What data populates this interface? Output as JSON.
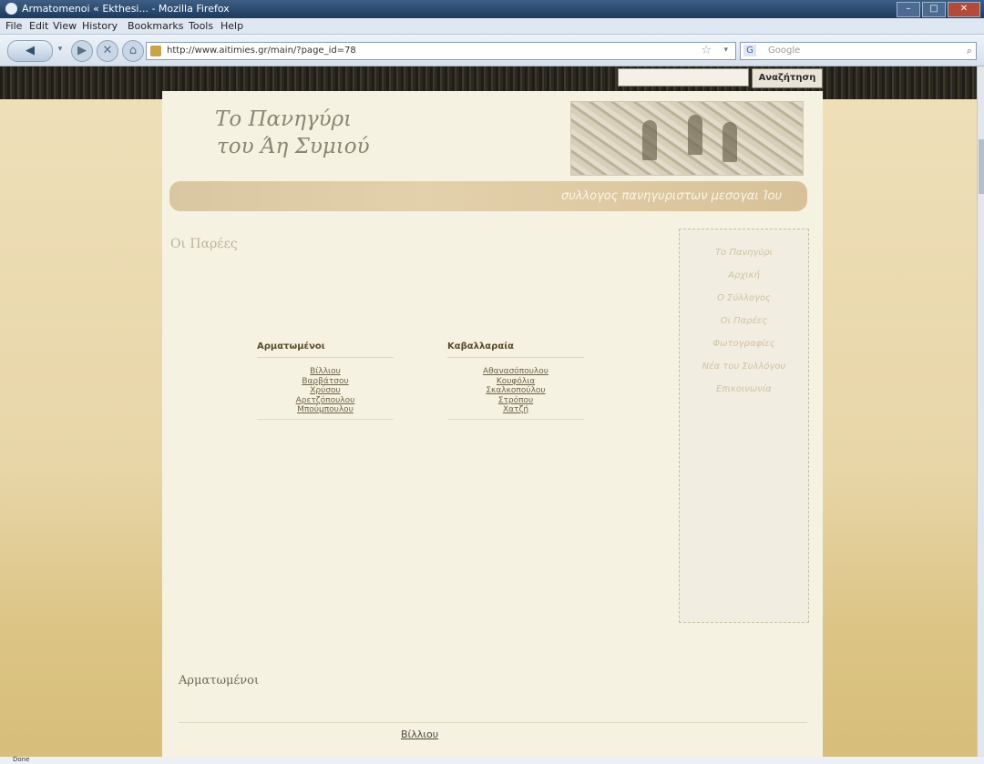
{
  "window": {
    "title": "Armatomenoi « Ekthesi... - Mozilla Firefox"
  },
  "menubar": {
    "items": [
      "File",
      "Edit",
      "View",
      "History",
      "Bookmarks",
      "Tools",
      "Help"
    ]
  },
  "nav": {
    "url": "http://www.aitimies.gr/main/?page_id=78",
    "search_placeholder": "Google"
  },
  "site": {
    "search_button": "Αναζήτηση",
    "logo_line1": "Το Πανηγύρι",
    "logo_line2": "του Άη Συμιού",
    "banner": "συλλογος πανηγυριστων μεσογαι Ίου",
    "page_heading": "Οι Παρέες",
    "groups": [
      {
        "title": "Αρματωμένοι",
        "items": [
          "Βίλλιου",
          "Βαρβάτσου",
          "Χρύσου",
          "Αρετζόπουλου",
          "Μπούμπουλου"
        ]
      },
      {
        "title": "Καβαλλαραία",
        "items": [
          "Αθανασόπουλου",
          "Κουφόλια",
          "Σκαλκοπούλου",
          "Στρόπου",
          "Χατζή"
        ]
      }
    ],
    "sidenav": [
      "Το Πανηγύρι",
      "Αρχική",
      "Ο Σύλλογος",
      "Οι Παρέες",
      "Φωτογραφίες",
      "Νέα του Συλλόγου",
      "Επικοινωνία"
    ],
    "section_heading": "Αρματωμένοι",
    "bottom_link": "Βίλλιου"
  },
  "status": {
    "text": "Done"
  }
}
